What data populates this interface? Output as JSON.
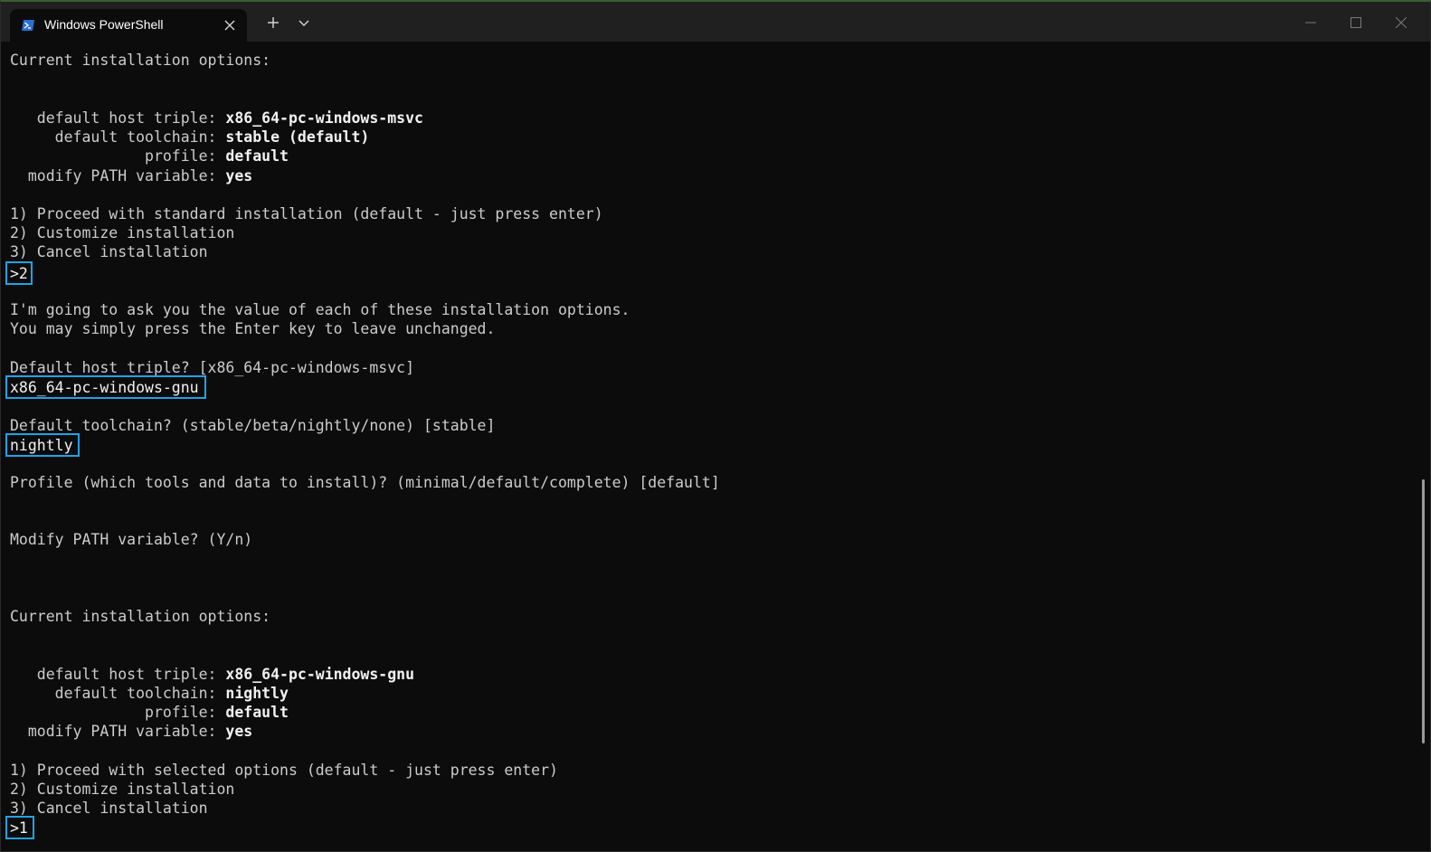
{
  "window": {
    "tab_title": "Windows PowerShell",
    "icons": {
      "tab": "powershell-icon",
      "close_tab": "close-icon",
      "new_tab": "plus-icon",
      "dropdown": "chevron-down-icon",
      "minimize": "minimize-icon",
      "maximize": "maximize-icon",
      "close_window": "close-icon"
    },
    "colors": {
      "background": "#0c0c0c",
      "titlebar": "#202020",
      "text": "#cccccc",
      "highlight_border": "#1ea3e8"
    }
  },
  "terminal": {
    "block1": {
      "heading": "Current installation options:",
      "options": [
        {
          "label": "   default host triple: ",
          "value": "x86_64-pc-windows-msvc"
        },
        {
          "label": "     default toolchain: ",
          "value": "stable (default)"
        },
        {
          "label": "               profile: ",
          "value": "default"
        },
        {
          "label": "  modify PATH variable: ",
          "value": "yes"
        }
      ],
      "menu": [
        "1) Proceed with standard installation (default - just press enter)",
        "2) Customize installation",
        "3) Cancel installation"
      ],
      "input": ">2"
    },
    "intro": [
      "I'm going to ask you the value of each of these installation options.",
      "You may simply press the Enter key to leave unchanged."
    ],
    "prompts": {
      "host_triple": {
        "question": "Default host triple? [x86_64-pc-windows-msvc]",
        "answer": "x86_64-pc-windows-gnu"
      },
      "toolchain": {
        "question": "Default toolchain? (stable/beta/nightly/none) [stable]",
        "answer": "nightly"
      },
      "profile": {
        "question": "Profile (which tools and data to install)? (minimal/default/complete) [default]"
      },
      "modify_path": {
        "question": "Modify PATH variable? (Y/n)"
      }
    },
    "block2": {
      "heading": "Current installation options:",
      "options": [
        {
          "label": "   default host triple: ",
          "value": "x86_64-pc-windows-gnu"
        },
        {
          "label": "     default toolchain: ",
          "value": "nightly"
        },
        {
          "label": "               profile: ",
          "value": "default"
        },
        {
          "label": "  modify PATH variable: ",
          "value": "yes"
        }
      ],
      "menu": [
        "1) Proceed with selected options (default - just press enter)",
        "2) Customize installation",
        "3) Cancel installation"
      ],
      "input": ">1"
    }
  }
}
